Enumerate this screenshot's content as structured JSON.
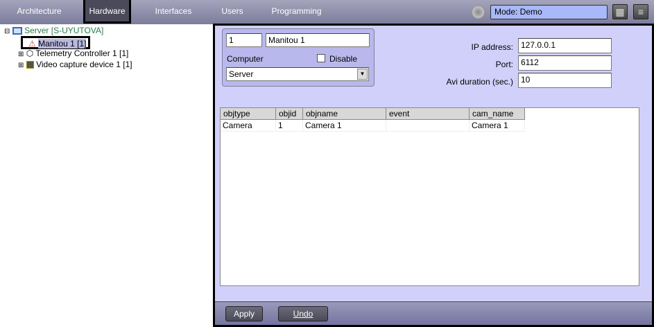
{
  "nav": {
    "tabs": [
      {
        "label": "Architecture"
      },
      {
        "label": "Hardware"
      },
      {
        "label": "Interfaces"
      },
      {
        "label": "Users"
      },
      {
        "label": "Programming"
      }
    ],
    "mode": "Mode: Demo"
  },
  "tree": {
    "root": "Server [S-UYUTOVA]",
    "children": [
      {
        "label": "Manitou 1 [1]"
      },
      {
        "label": "Telemetry Controller 1 [1]"
      },
      {
        "label": "Video capture device 1 [1]"
      }
    ]
  },
  "form": {
    "id": "1",
    "name": "Manitou 1",
    "computer_label": "Computer",
    "disable_label": "Disable",
    "computer_value": "Server",
    "ip_label": "IP address:",
    "ip_value": "127.0.0.1",
    "port_label": "Port:",
    "port_value": "6112",
    "avi_label": "Avi duration (sec.)",
    "avi_value": "10"
  },
  "table": {
    "columns": [
      "objtype",
      "objid",
      "objname",
      "event",
      "cam_name"
    ],
    "rows": [
      [
        "Camera",
        "1",
        "Camera 1",
        "",
        "Camera 1"
      ]
    ]
  },
  "buttons": {
    "apply": "Apply",
    "undo": "Undo"
  }
}
